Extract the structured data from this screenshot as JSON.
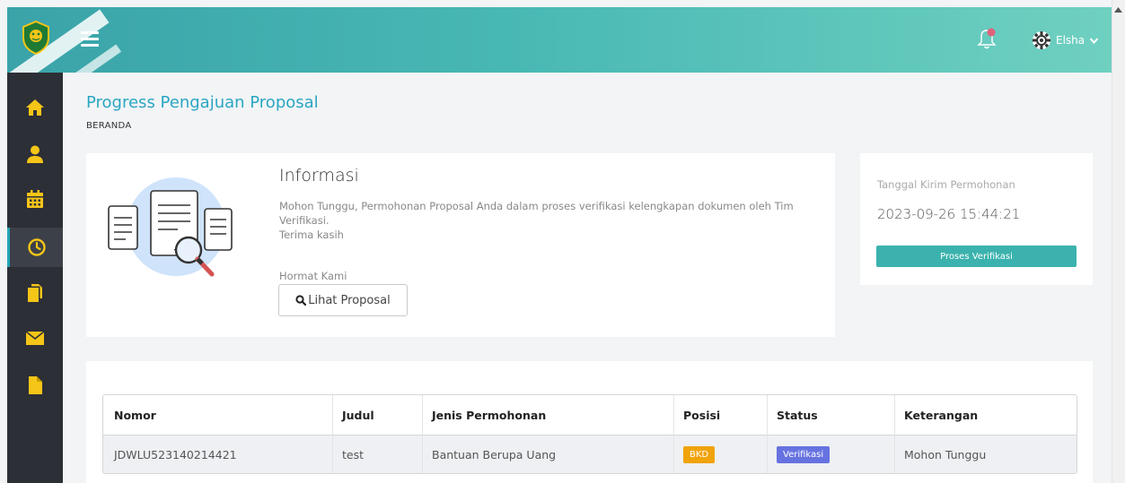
{
  "header": {
    "user_name": "Elsha"
  },
  "page": {
    "title": "Progress Pengajuan Proposal",
    "breadcrumb": "BERANDA"
  },
  "info": {
    "title": "Informasi",
    "message_line1": "Mohon Tunggu, Permohonan Proposal Anda dalam proses verifikasi kelengkapan dokumen oleh Tim Verifikasi.",
    "message_line2": "Terima kasih",
    "regards": "Hormat Kami",
    "view_button_label": "Lihat Proposal"
  },
  "submission": {
    "date_label": "Tanggal Kirim Permohonan",
    "date_value": "2023-09-26 15:44:21",
    "status_button": "Proses Verifikasi"
  },
  "table": {
    "headers": [
      "Nomor",
      "Judul",
      "Jenis Permohonan",
      "Posisi",
      "Status",
      "Keterangan"
    ],
    "rows": [
      {
        "nomor": "JDWLU523140214421",
        "judul": "test",
        "jenis": "Bantuan Berupa Uang",
        "posisi": "BKD",
        "status": "Verifikasi",
        "keterangan": "Mohon Tunggu"
      }
    ]
  },
  "colors": {
    "accent": "#2aa6c1",
    "sidebar": "#2d2f36",
    "icon_yellow": "#f5c518",
    "status_teal": "#3bb2ad",
    "badge_orange": "#f0a30a",
    "badge_purple": "#6672e0"
  },
  "icons": {
    "sidebar": [
      "home-icon",
      "user-icon",
      "calendar-icon",
      "clock-icon",
      "copy-icon",
      "envelope-icon",
      "file-icon"
    ],
    "header": [
      "hamburger-icon",
      "bell-icon",
      "gear-icon",
      "chevron-down-icon"
    ]
  }
}
